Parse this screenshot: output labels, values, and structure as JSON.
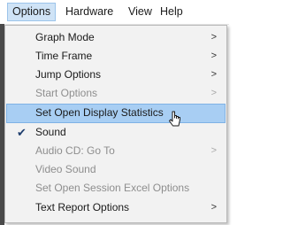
{
  "menubar": {
    "items": [
      "Options",
      "Hardware",
      "View",
      "Help"
    ]
  },
  "menu": {
    "items": [
      {
        "label": "Graph Mode",
        "submenu": true,
        "disabled": false
      },
      {
        "label": "Time Frame",
        "submenu": true,
        "disabled": false
      },
      {
        "label": "Jump Options",
        "submenu": true,
        "disabled": false
      },
      {
        "label": "Start Options",
        "submenu": true,
        "disabled": true
      },
      {
        "label": "Set Open Display Statistics",
        "submenu": false,
        "disabled": false,
        "highlighted": true
      },
      {
        "label": "Sound",
        "submenu": false,
        "disabled": false,
        "checked": true
      },
      {
        "label": "Audio CD: Go To",
        "submenu": true,
        "disabled": true
      },
      {
        "label": "Video Sound",
        "submenu": false,
        "disabled": true
      },
      {
        "label": "Set Open Session Excel Options",
        "submenu": false,
        "disabled": true
      },
      {
        "label": "Text Report Options",
        "submenu": true,
        "disabled": false
      }
    ],
    "arrow_glyph": ">",
    "check_glyph": "✔"
  },
  "colors": {
    "highlight": "#a8cef3",
    "menu_bg": "#f2f2f2",
    "disabled_text": "#8e8e8e"
  }
}
